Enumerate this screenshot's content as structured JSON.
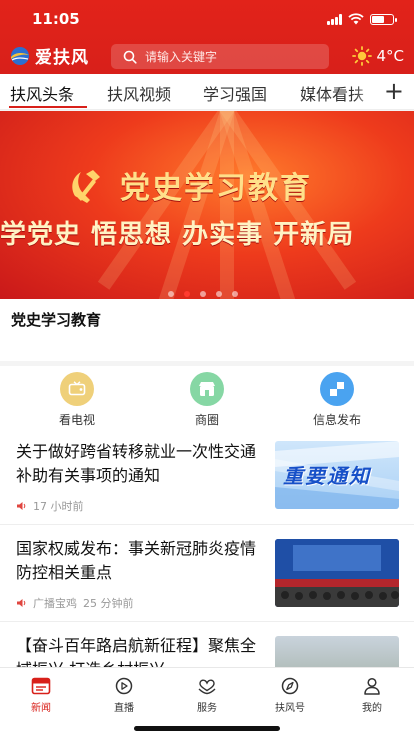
{
  "status_bar": {
    "time": "11:05"
  },
  "header": {
    "app_name": "爱扶风",
    "search_placeholder": "请输入关键字",
    "temperature": "4°C"
  },
  "tabs": [
    {
      "label": "扶风头条",
      "active": true
    },
    {
      "label": "扶风视频"
    },
    {
      "label": "学习强国"
    },
    {
      "label": "媒体看扶"
    }
  ],
  "tab_add": "+",
  "banner": {
    "title": "党史学习教育",
    "slogan": "学党史 悟思想 办实事 开新局",
    "caption": "党史学习教育",
    "slide_count": 5,
    "active_slide": 2
  },
  "quick_entries": [
    {
      "label": "看电视",
      "icon": "tv-icon",
      "color": "#efd07a"
    },
    {
      "label": "商圈",
      "icon": "shop-icon",
      "color": "#86d7a4"
    },
    {
      "label": "信息发布",
      "icon": "publish-icon",
      "color": "#4aa3f0"
    }
  ],
  "news": [
    {
      "title": "关于做好跨省转移就业一次性交通补助有关事项的通知",
      "source": "",
      "time": "17 小时前",
      "thumb_text": "重要通知"
    },
    {
      "title": "国家权威发布：事关新冠肺炎疫情防控相关重点",
      "source": "广播宝鸡",
      "time": "25 分钟前"
    },
    {
      "title": "【奋斗百年路启航新征程】聚焦全域振兴 打造乡村振兴",
      "source": "",
      "time": ""
    }
  ],
  "bottom_nav": [
    {
      "label": "新闻",
      "icon": "news-icon",
      "active": true
    },
    {
      "label": "直播",
      "icon": "live-icon"
    },
    {
      "label": "服务",
      "icon": "service-icon"
    },
    {
      "label": "扶风号",
      "icon": "compass-icon"
    },
    {
      "label": "我的",
      "icon": "user-icon"
    }
  ],
  "colors": {
    "brand_red": "#d8201a",
    "banner_gold": "#ffe08a"
  }
}
